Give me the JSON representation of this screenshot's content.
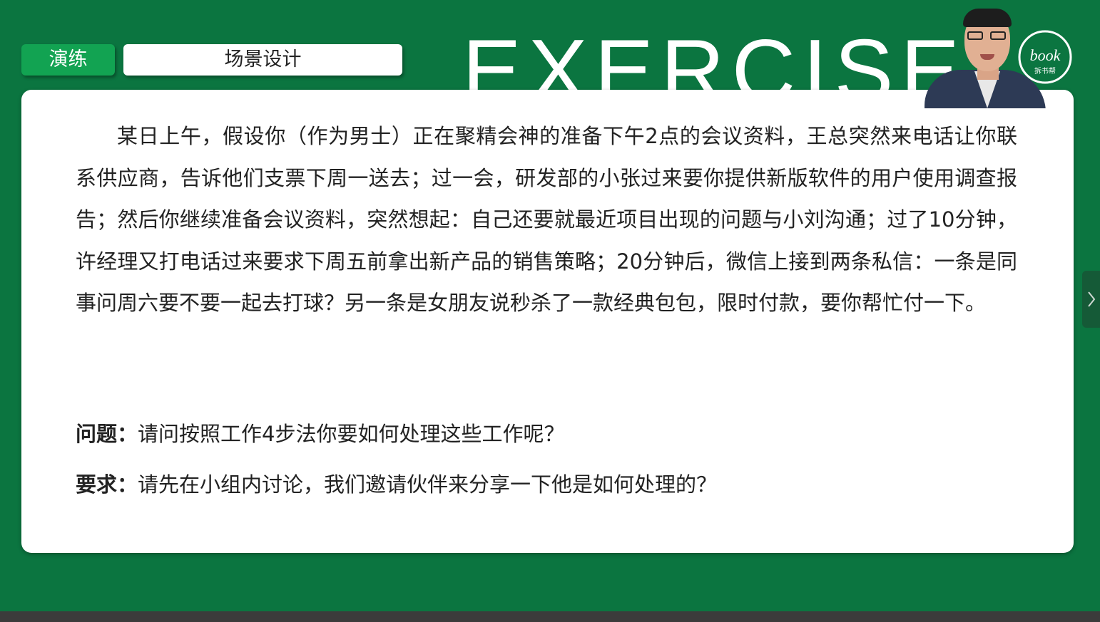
{
  "slide": {
    "watermark": "EXERCISE",
    "tag_label": "演练",
    "topic_title": "场景设计",
    "scenario_text": "某日上午，假设你（作为男士）正在聚精会神的准备下午2点的会议资料，王总突然来电话让你联系供应商，告诉他们支票下周一送去；过一会，研发部的小张过来要你提供新版软件的用户使用调查报告；然后你继续准备会议资料，突然想起：自己还要就最近项目出现的问题与小刘沟通；过了10分钟，许经理又打电话过来要求下周五前拿出新产品的销售策略；20分钟后，微信上接到两条私信：一条是同事问周六要不要一起去打球？另一条是女朋友说秒杀了一款经典包包，限时付款，要你帮忙付一下。",
    "question_label": "问题：",
    "question_text": "请问按照工作4步法你要如何处理这些工作呢？",
    "request_label": "要求：",
    "request_text": "请先在小组内讨论，我们邀请伙伴来分享一下他是如何处理的？"
  },
  "logo": {
    "main_text": "book",
    "sub_text": "拆书帮"
  },
  "colors": {
    "background": "#0b7540",
    "tag_green": "#12a352",
    "card": "#ffffff"
  },
  "icons": {
    "side_handle": "chevron-right-icon"
  }
}
